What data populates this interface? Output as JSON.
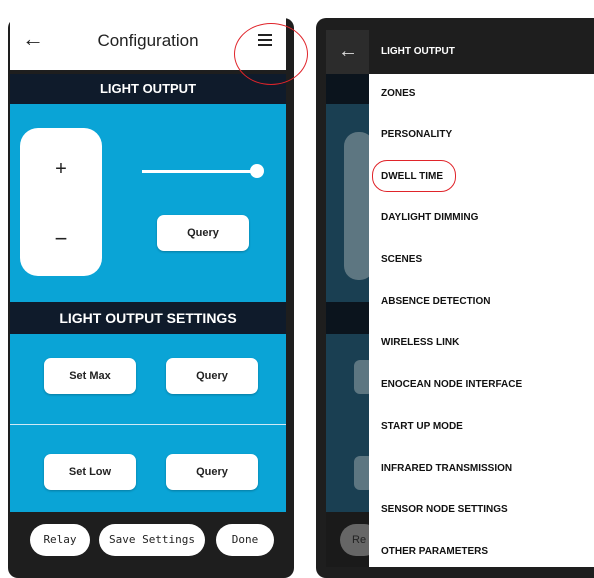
{
  "left_screen": {
    "header": {
      "back_icon": "←",
      "title": "Configuration",
      "menu_icon": "hamburger-icon"
    },
    "light_output": {
      "heading": "LIGHT OUTPUT",
      "plus": "+",
      "minus": "−",
      "query_label": "Query"
    },
    "light_output_settings": {
      "heading": "LIGHT OUTPUT SETTINGS",
      "set_max_label": "Set Max",
      "query_max_label": "Query",
      "set_low_label": "Set Low",
      "query_low_label": "Query"
    },
    "bottom_bar": {
      "relay": "Relay",
      "save": "Save Settings",
      "done": "Done"
    }
  },
  "right_screen": {
    "back_icon": "←",
    "peek_label": "Re",
    "menu_header": "LIGHT OUTPUT",
    "menu_items": [
      "ZONES",
      "PERSONALITY",
      "DWELL TIME",
      "DAYLIGHT DIMMING",
      "SCENES",
      "ABSENCE DETECTION",
      "WIRELESS LINK",
      "ENOCEAN NODE INTERFACE",
      "START UP MODE",
      "INFRARED TRANSMISSION",
      "SENSOR NODE SETTINGS",
      "OTHER PARAMETERS"
    ],
    "highlighted_item": "DWELL TIME"
  },
  "colors": {
    "accent_blue": "#0aa4d6",
    "band_dark": "#0f1b2b",
    "highlight_red": "#e0242a"
  }
}
